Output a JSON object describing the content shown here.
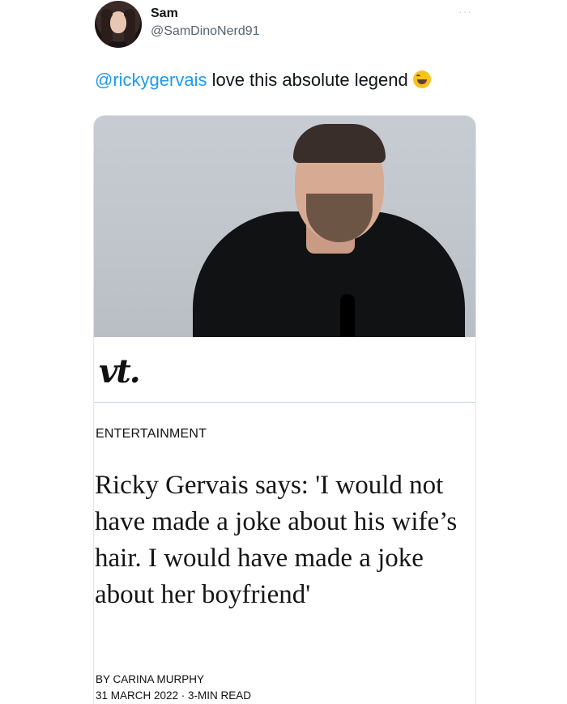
{
  "tweet": {
    "author_name": "Sam",
    "author_handle": "@SamDinoNerd91",
    "more_label": "···",
    "mention": "@rickygervais",
    "text": " love this absolute legend",
    "emoji": "face-with-tears-of-joy-icon"
  },
  "article": {
    "logo": "vt.",
    "category": "ENTERTAINMENT",
    "headline": "Ricky Gervais says: 'I would not have made a joke about his wife’s hair. I would have made a joke about her boyfriend'",
    "byline": "BY CARINA MURPHY",
    "dateline": "31 MARCH 2022 · 3-MIN READ"
  },
  "colors": {
    "mention": "#1d9bf0",
    "handle": "#536471",
    "divider": "#bcd3e8"
  }
}
